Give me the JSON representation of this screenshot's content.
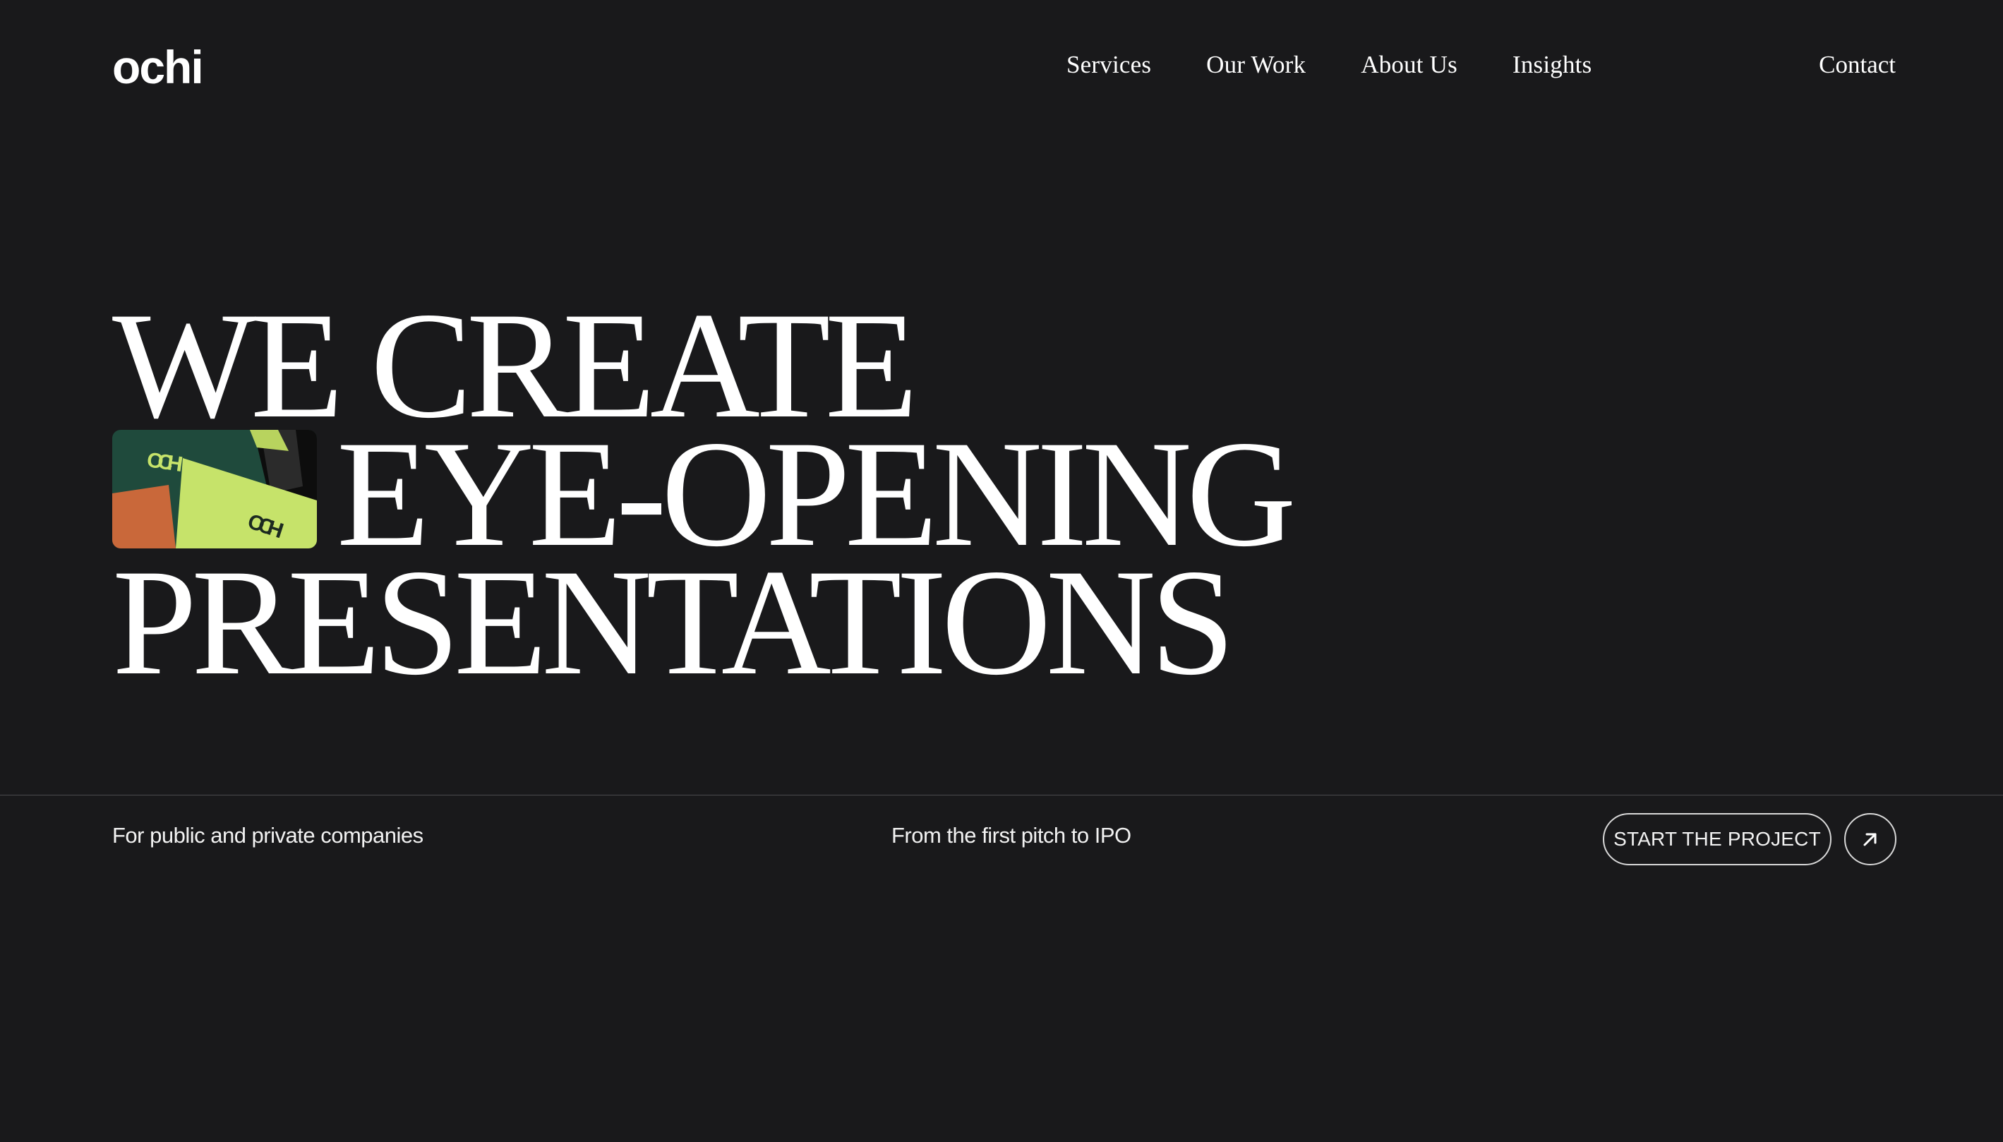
{
  "brand": {
    "logo_text": "ochi",
    "background_color": "#19191b",
    "text_color": "#ffffff",
    "thumbnail_colors": [
      "#1f4a3c",
      "#c6e36a",
      "#c9683a",
      "#0d0d0d"
    ]
  },
  "nav": {
    "items": [
      {
        "label": "Services"
      },
      {
        "label": "Our Work"
      },
      {
        "label": "About Us"
      },
      {
        "label": "Insights"
      }
    ],
    "contact_label": "Contact"
  },
  "hero": {
    "lines": [
      "WE CREATE",
      "EYE-OPENING",
      "PRESENTATIONS"
    ],
    "thumbnail_logo_text": "ochi"
  },
  "footer_row": {
    "left_text": "For public and private companies",
    "middle_text": "From the first pitch to IPO",
    "cta_label": "START THE PROJECT",
    "cta_icon": "arrow-up-right-icon"
  }
}
